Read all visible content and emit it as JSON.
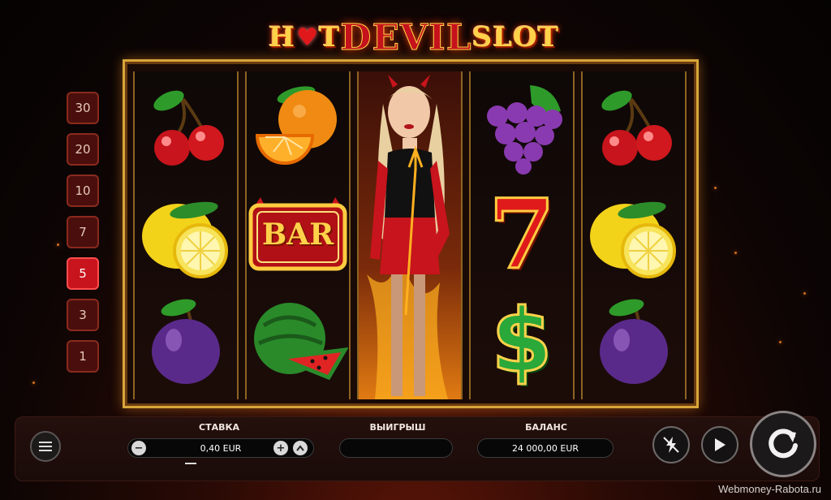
{
  "logo": {
    "part1": "H",
    "heart": "♥",
    "part2": "T",
    "devil": "DEVIL",
    "part3": "SLOT"
  },
  "bet_ladder": [
    "30",
    "20",
    "10",
    "7",
    "5",
    "3",
    "1"
  ],
  "bet_ladder_active": "5",
  "reels": [
    [
      "cherry",
      "lemon",
      "plum"
    ],
    [
      "orange",
      "bar",
      "watermelon"
    ],
    [
      "devil-girl"
    ],
    [
      "grapes",
      "seven",
      "dollar"
    ],
    [
      "cherry",
      "lemon",
      "plum"
    ]
  ],
  "bar_symbol_text": "BAR",
  "seven_symbol_text": "7",
  "dollar_symbol_text": "$",
  "bottom_bar": {
    "bet_label": "СТАВКА",
    "bet_value": "0,40 EUR",
    "minus": "−",
    "plus": "+",
    "win_label": "ВЫИГРЫШ",
    "win_value": "",
    "balance_label": "БАЛАНС",
    "balance_value": "24 000,00 EUR"
  },
  "watermark": "Webmoney-Rabota.ru",
  "colors": {
    "accent_gold": "#d8a63a",
    "active_red": "#c8141c"
  }
}
